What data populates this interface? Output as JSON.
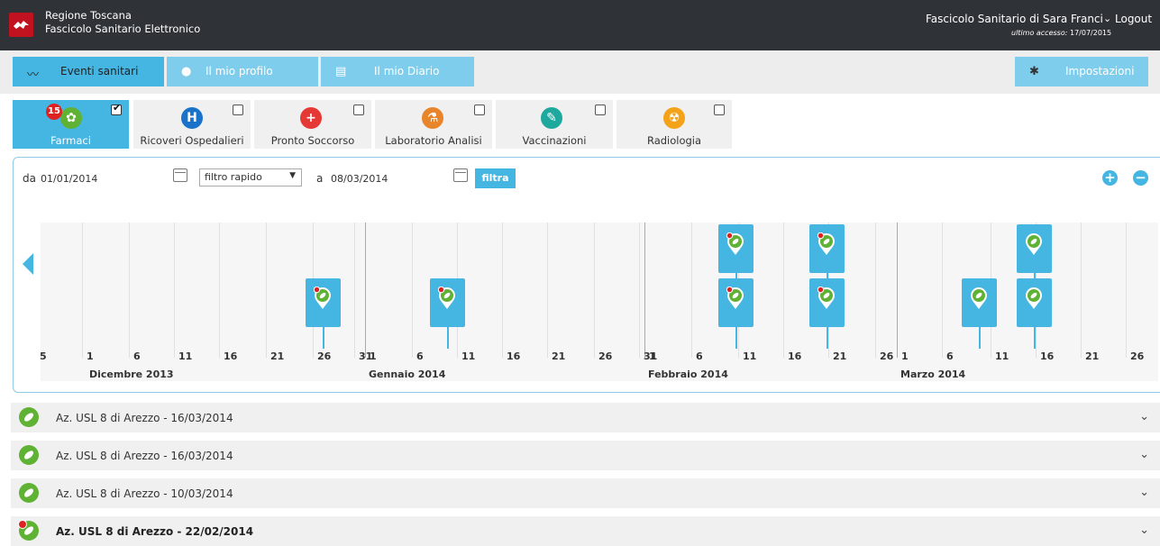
{
  "header": {
    "brand_line1": "Regione Toscana",
    "brand_line2": "Fascicolo Sanitario Elettronico",
    "user_name": "Fascicolo Sanitario di Sara Franci",
    "logout": "Logout",
    "last_access_label": "ultimo accesso:",
    "last_access_date": "17/07/2015",
    "logo_icon": "region-crest-icon"
  },
  "nav": {
    "tabs": [
      {
        "label": "Eventi sanitari",
        "icon": "heartbeat-icon"
      },
      {
        "label": "Il mio profilo",
        "icon": "user-icon"
      },
      {
        "label": "Il mio Diario",
        "icon": "diary-icon"
      }
    ],
    "settings_label": "Impostazioni",
    "settings_icon": "gear-icon"
  },
  "categories": [
    {
      "label": "Farmaci",
      "icon": "pills-icon",
      "color": "#5fb234",
      "badge": "15",
      "checked": true
    },
    {
      "label": "Ricoveri Ospedalieri",
      "icon": "hospital-icon",
      "color": "#1a73c8",
      "checked": false
    },
    {
      "label": "Pronto Soccorso",
      "icon": "first-aid-icon",
      "color": "#e53935",
      "checked": false
    },
    {
      "label": "Laboratorio Analisi",
      "icon": "flask-icon",
      "color": "#e8842a",
      "checked": false
    },
    {
      "label": "Vaccinazioni",
      "icon": "syringe-icon",
      "color": "#1fa89e",
      "checked": false
    },
    {
      "label": "Radiologia",
      "icon": "radiation-icon",
      "color": "#f3a21a",
      "checked": false
    }
  ],
  "filter": {
    "from_label": "da",
    "from_value": "01/01/2014",
    "quick_filter": "filtro rapido",
    "to_label": "a",
    "to_value": "08/03/2014",
    "button": "filtra"
  },
  "timeline": {
    "months": [
      "Dicembre 2013",
      "Gennaio 2014",
      "Febbraio 2014",
      "Marzo 2014"
    ],
    "tick_labels": [
      "5",
      "1",
      "6",
      "11",
      "16",
      "21",
      "26",
      "31",
      "1",
      "6",
      "11",
      "16",
      "21",
      "26",
      "31",
      "1",
      "6",
      "11",
      "16",
      "21",
      "26",
      "1",
      "6",
      "11",
      "16",
      "21",
      "26"
    ],
    "events": [
      {
        "date": "27/12/2013",
        "row": "lower",
        "new": true
      },
      {
        "date": "10/01/2014",
        "row": "lower",
        "new": true
      },
      {
        "date": "11/02/2014",
        "row": "upper",
        "new": true
      },
      {
        "date": "11/02/2014",
        "row": "lower",
        "new": true
      },
      {
        "date": "21/02/2014",
        "row": "upper",
        "new": true
      },
      {
        "date": "21/02/2014",
        "row": "lower",
        "new": true
      },
      {
        "date": "10/03/2014",
        "row": "lower",
        "new": false
      },
      {
        "date": "16/03/2014",
        "row": "upper",
        "new": false
      },
      {
        "date": "16/03/2014",
        "row": "lower",
        "new": false
      }
    ]
  },
  "records": [
    {
      "text": "Az. USL 8 di Arezzo - 16/03/2014",
      "bold": false,
      "new": false
    },
    {
      "text": "Az. USL 8 di Arezzo - 16/03/2014",
      "bold": false,
      "new": false
    },
    {
      "text": "Az. USL 8 di Arezzo - 10/03/2014",
      "bold": false,
      "new": false
    },
    {
      "text": "Az. USL 8 di Arezzo - 22/02/2014",
      "bold": true,
      "new": true
    }
  ],
  "colors": {
    "accent": "#45b5e2",
    "topbar": "#2f3337",
    "farmaci": "#5fb234"
  }
}
